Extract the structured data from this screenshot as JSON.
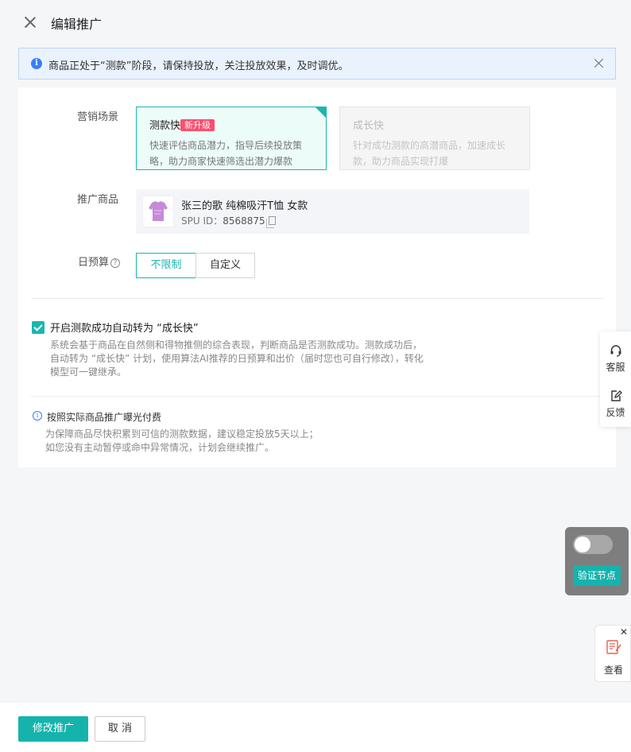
{
  "header": {
    "title": "编辑推广"
  },
  "alert": {
    "text": "商品正处于“测款”阶段，请保持投放，关注投放效果，及时调优。"
  },
  "form": {
    "scene_label": "营销场景",
    "scenes": [
      {
        "title": "测款快",
        "badge": "新升级",
        "desc": "快速评估商品潜力，指导后续投放策略，助力商家快速筛选出潜力爆款",
        "selected": true
      },
      {
        "title": "成长快",
        "desc": "针对成功测款的高潜商品，加速成长款，助力商品实现打爆",
        "disabled": true
      }
    ],
    "goods_label": "推广商品",
    "goods": {
      "name": "张三的歌 纯棉吸汗T恤 女款",
      "spu_prefix": "SPU ID：",
      "spu_id": "8568875"
    },
    "budget_label": "日预算",
    "budget_help": "?",
    "budget_options": [
      "不限制",
      "自定义"
    ],
    "budget_selected": "不限制"
  },
  "auto_convert": {
    "checked": true,
    "label": "开启测款成功自动转为 “成长快”",
    "desc": "系统会基于商品在自然侧和得物推侧的综合表现，判断商品是否测款成功。测款成功后，自动转为 “成长快” 计划，使用算法AI推荐的日预算和出价（届时您也可自行修改），转化模型可一键继承。"
  },
  "notice": {
    "title": "按照实际商品推广曝光付费",
    "lines": [
      "为保障商品尽快积累到可信的测款数据，建议稳定投放5天以上；",
      "如您没有主动暂停或命中异常情况，计划会继续推广。"
    ]
  },
  "side_widget": {
    "service": "客服",
    "feedback": "反馈"
  },
  "debug_panel": {
    "toggle_on": false,
    "button": "验证节点"
  },
  "view_widget": {
    "close": "✕",
    "label": "查看"
  },
  "footer": {
    "submit": "修改推广",
    "cancel": "取 消"
  },
  "colors": {
    "accent": "#1bb6b0",
    "badge": "#ff4d6d",
    "info": "#3a7ef5"
  }
}
